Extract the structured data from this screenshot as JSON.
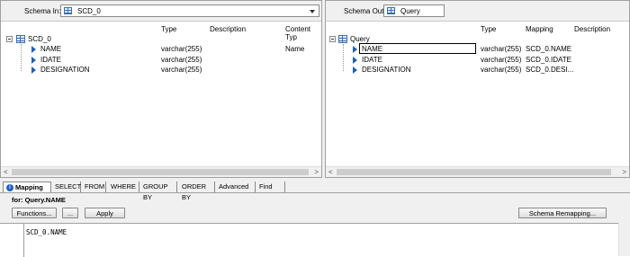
{
  "schema_in": {
    "label": "Schema In:",
    "value": "SCD_0",
    "columns": [
      "Type",
      "Description",
      "Content Typ"
    ],
    "root": "SCD_0",
    "fields": [
      {
        "name": "NAME",
        "type": "varchar(255)",
        "content_type": "Name"
      },
      {
        "name": "IDATE",
        "type": "varchar(255)",
        "content_type": ""
      },
      {
        "name": "DESIGNATION",
        "type": "varchar(255)",
        "content_type": ""
      }
    ]
  },
  "schema_out": {
    "label": "Schema Out:",
    "value": "Query",
    "columns": [
      "Type",
      "Mapping",
      "Description"
    ],
    "root": "Query",
    "fields": [
      {
        "name": "NAME",
        "type": "varchar(255)",
        "mapping": "SCD_0.NAME"
      },
      {
        "name": "IDATE",
        "type": "varchar(255)",
        "mapping": "SCD_0.IDATE"
      },
      {
        "name": "DESIGNATION",
        "type": "varchar(255)",
        "mapping": "SCD_0.DESI..."
      }
    ]
  },
  "tabs": [
    "Mapping",
    "SELECT",
    "FROM",
    "WHERE",
    "GROUP BY",
    "ORDER BY",
    "Advanced",
    "Find"
  ],
  "for_label": "for: Query.NAME",
  "buttons": {
    "functions": "Functions...",
    "ellipsis": "...",
    "apply": "Apply",
    "schema_remapping": "Schema Remapping..."
  },
  "editor_text": "SCD_0.NAME",
  "scroll": {
    "left": "<",
    "right": ">"
  },
  "colors": {
    "icon_blue": "#1f5fb8",
    "accent": "#3a6fb0"
  }
}
